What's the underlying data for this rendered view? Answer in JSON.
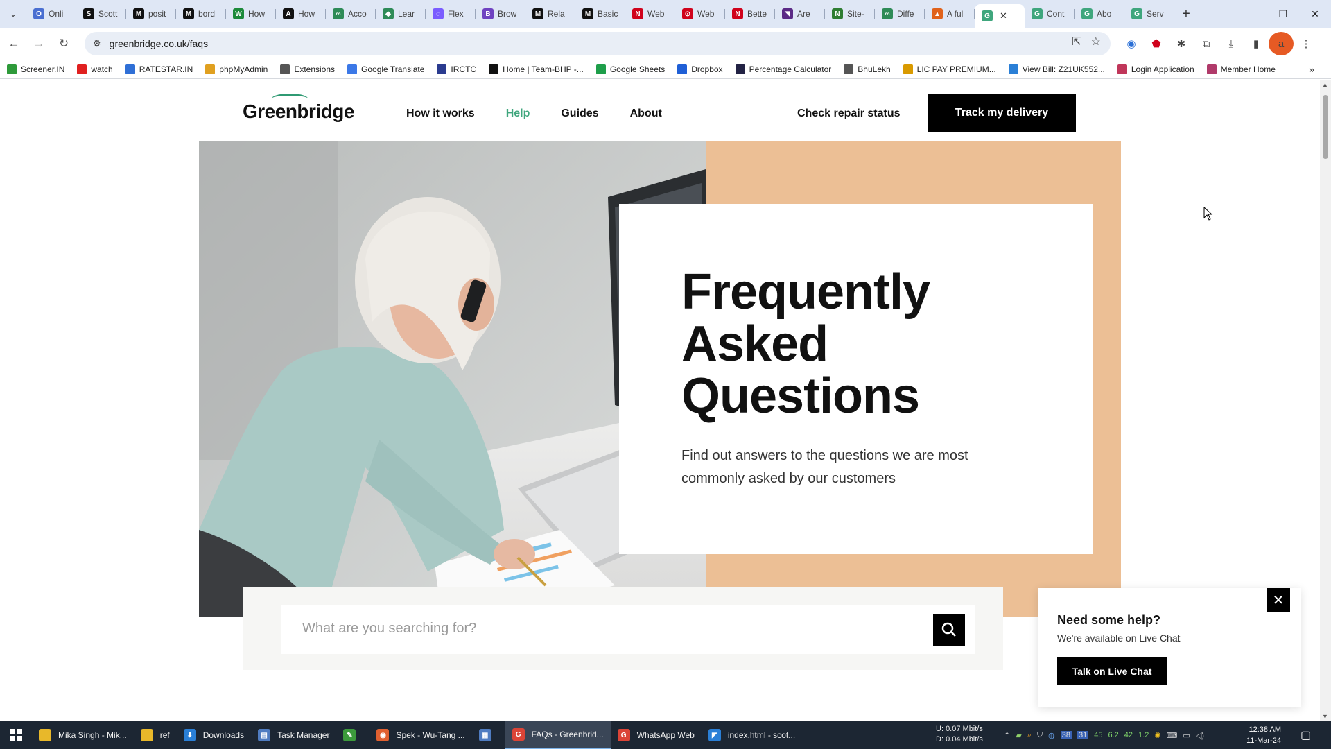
{
  "browser": {
    "tabs": [
      {
        "label": "Onli",
        "icon": "O",
        "color": "#4a6fd1"
      },
      {
        "label": "Scott",
        "icon": "S",
        "color": "#111111"
      },
      {
        "label": "posit",
        "icon": "M",
        "color": "#111111"
      },
      {
        "label": "bord",
        "icon": "M",
        "color": "#111111"
      },
      {
        "label": "How",
        "icon": "W",
        "color": "#1c8a3a"
      },
      {
        "label": "How",
        "icon": "A",
        "color": "#111111"
      },
      {
        "label": "Acco",
        "icon": "∞",
        "color": "#2e8b57"
      },
      {
        "label": "Lear",
        "icon": "◆",
        "color": "#2e8b57"
      },
      {
        "label": "Flex",
        "icon": "◌",
        "color": "#7a5cff"
      },
      {
        "label": "Brow",
        "icon": "B",
        "color": "#6f42c1"
      },
      {
        "label": "Rela",
        "icon": "M",
        "color": "#111111"
      },
      {
        "label": "Basic",
        "icon": "M",
        "color": "#111111"
      },
      {
        "label": "Web",
        "icon": "N",
        "color": "#d0021b"
      },
      {
        "label": "Web",
        "icon": "⊙",
        "color": "#d0021b"
      },
      {
        "label": "Bette",
        "icon": "N",
        "color": "#d0021b"
      },
      {
        "label": "Are",
        "icon": "◥",
        "color": "#5b2a86"
      },
      {
        "label": "Site-",
        "icon": "N",
        "color": "#2e7d32"
      },
      {
        "label": "Diffe",
        "icon": "∞",
        "color": "#2e8b57"
      },
      {
        "label": "A ful",
        "icon": "▲",
        "color": "#e0621b"
      },
      {
        "label": "",
        "icon": "G",
        "color": "#3fa67d",
        "active": true
      },
      {
        "label": "Cont",
        "icon": "G",
        "color": "#3fa67d"
      },
      {
        "label": "Abo",
        "icon": "G",
        "color": "#3fa67d"
      },
      {
        "label": "Serv",
        "icon": "G",
        "color": "#3fa67d"
      }
    ],
    "url": "greenbridge.co.uk/faqs",
    "avatar_letter": "a",
    "bookmarks": [
      {
        "label": "Screener.IN",
        "color": "#2e9a3a"
      },
      {
        "label": "watch",
        "color": "#e02020"
      },
      {
        "label": "RATESTAR.IN",
        "color": "#2f6fd6"
      },
      {
        "label": "phpMyAdmin",
        "color": "#e0a020"
      },
      {
        "label": "Extensions",
        "color": "#555555"
      },
      {
        "label": "Google Translate",
        "color": "#3b78e7"
      },
      {
        "label": "IRCTC",
        "color": "#2a3b8f"
      },
      {
        "label": "Home | Team-BHP -...",
        "color": "#111111"
      },
      {
        "label": "Google Sheets",
        "color": "#1e9e4a"
      },
      {
        "label": "Dropbox",
        "color": "#1f5fd6"
      },
      {
        "label": "Percentage Calculator",
        "color": "#222244"
      },
      {
        "label": "BhuLekh",
        "color": "#555555"
      },
      {
        "label": "LIC PAY PREMIUM...",
        "color": "#d99a00"
      },
      {
        "label": "View Bill: Z21UK552...",
        "color": "#2a7fd6"
      },
      {
        "label": "Login Application",
        "color": "#c0365a"
      },
      {
        "label": "Member Home",
        "color": "#b03a6a"
      }
    ]
  },
  "site": {
    "logo": "Greenbridge",
    "nav": [
      "How it works",
      "Help",
      "Guides",
      "About"
    ],
    "repair_link": "Check repair status",
    "track_button": "Track my delivery",
    "hero_title_lines": [
      "Frequently",
      "Asked",
      "Questions"
    ],
    "hero_subtitle": "Find out answers to the questions we are most commonly asked by our customers",
    "search_placeholder": "What are you searching for?",
    "accent": "#3fa67d",
    "peach": "#ecbf95"
  },
  "help_widget": {
    "title": "Need some help?",
    "text": "We're available on Live Chat",
    "button": "Talk on Live Chat"
  },
  "taskbar": {
    "items": [
      {
        "label": "Mika Singh - Mik...",
        "icon": "",
        "color": "#e8b82a"
      },
      {
        "label": "ref",
        "icon": "",
        "color": "#e8b82a"
      },
      {
        "label": "Downloads",
        "icon": "⬇",
        "color": "#2a7fd6"
      },
      {
        "label": "Task Manager",
        "icon": "▤",
        "color": "#4f7cc1"
      },
      {
        "label": "",
        "icon": "✎",
        "color": "#3c9a3c"
      },
      {
        "label": "Spek - Wu-Tang ...",
        "icon": "◉",
        "color": "#e06030"
      },
      {
        "label": "",
        "icon": "▦",
        "color": "#4f7cc1"
      },
      {
        "label": "FAQs - Greenbrid...",
        "icon": "G",
        "color": "#db4437",
        "active": true
      },
      {
        "label": "WhatsApp Web",
        "icon": "G",
        "color": "#db4437"
      },
      {
        "label": "index.html - scot...",
        "icon": "◤",
        "color": "#2a7fd6"
      }
    ],
    "net_up": "0.07 Mbit/s",
    "net_down": "0.04 Mbit/s",
    "net_up_label": "U:",
    "net_down_label": "D:",
    "tray_numbers": [
      "45",
      "6.2",
      "42",
      "1.2"
    ],
    "time": "12:38 AM",
    "date": "11-Mar-24"
  }
}
